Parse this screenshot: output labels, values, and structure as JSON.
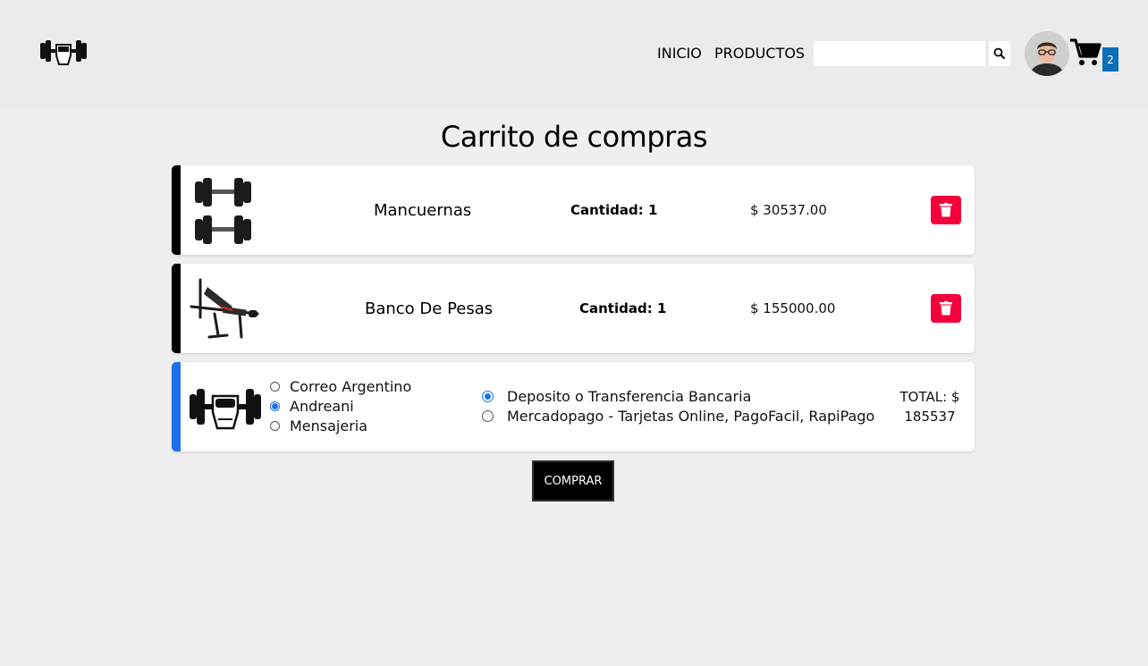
{
  "header": {
    "nav": {
      "inicio": "INICIO",
      "productos": "PRODUCTOS"
    },
    "search": {
      "value": "",
      "placeholder": ""
    },
    "cart_count": "2"
  },
  "page_title": "Carrito de compras",
  "cart_items": [
    {
      "name": "Mancuernas",
      "quantity_label": "Cantidad: 1",
      "price": "$ 30537.00",
      "icon": "dumbbells-image"
    },
    {
      "name": "Banco De Pesas",
      "quantity_label": "Cantidad: 1",
      "price": "$ 155000.00",
      "icon": "weight-bench-image"
    }
  ],
  "shipping_options": [
    {
      "label": "Correo Argentino",
      "selected": false
    },
    {
      "label": "Andreani",
      "selected": true
    },
    {
      "label": "Mensajeria",
      "selected": false
    }
  ],
  "payment_options": [
    {
      "label": "Deposito o Transferencia Bancaria",
      "selected": true
    },
    {
      "label": "Mercadopago - Tarjetas Online, PagoFacil, RapiPago",
      "selected": false
    }
  ],
  "total": {
    "label": "TOTAL: $",
    "value": "185537"
  },
  "buy_button": "COMPRAR",
  "colors": {
    "accent_blue": "#1f6feb",
    "delete_red": "#f4003a",
    "background": "#efefef"
  }
}
